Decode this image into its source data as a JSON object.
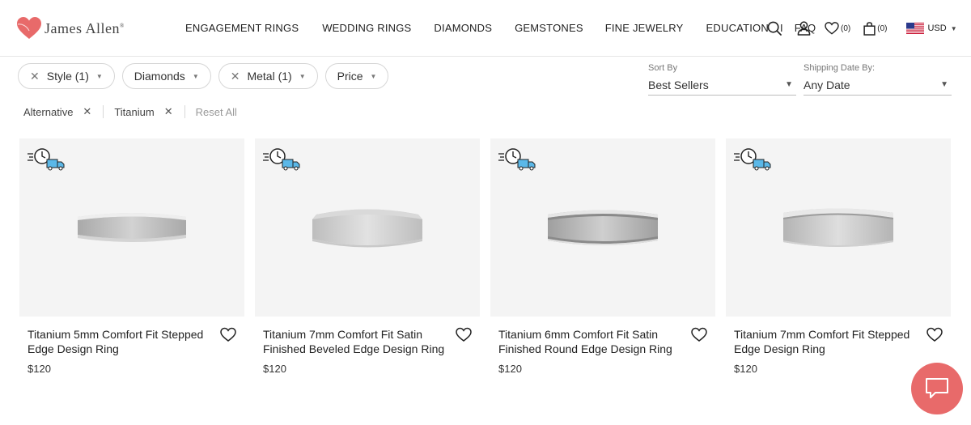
{
  "brand": {
    "name": "James Allen",
    "trademark": "®",
    "accent_color": "#e86a6a"
  },
  "nav": {
    "items": [
      "ENGAGEMENT RINGS",
      "WEDDING RINGS",
      "DIAMONDS",
      "GEMSTONES",
      "FINE JEWELRY",
      "EDUCATION"
    ],
    "separator": "I",
    "faq": "FAQ"
  },
  "header_icons": {
    "wishlist_count": "(0)",
    "cart_count": "(0)",
    "currency": "USD"
  },
  "filters": {
    "style": "Style (1)",
    "diamonds": "Diamonds",
    "metal": "Metal (1)",
    "price": "Price"
  },
  "sort": {
    "sort_by_label": "Sort By",
    "sort_by_value": "Best Sellers",
    "shipping_label": "Shipping Date By:",
    "shipping_value": "Any Date"
  },
  "applied_filters": {
    "tag1": "Alternative",
    "tag2": "Titanium",
    "reset": "Reset All"
  },
  "products": [
    {
      "title": "Titanium 5mm Comfort Fit Stepped Edge Design Ring",
      "price": "$120"
    },
    {
      "title": "Titanium 7mm Comfort Fit Satin Finished Beveled Edge Design Ring",
      "price": "$120"
    },
    {
      "title": "Titanium 6mm Comfort Fit Satin Finished Round Edge Design Ring",
      "price": "$120"
    },
    {
      "title": "Titanium 7mm Comfort Fit Stepped Edge Design Ring",
      "price": "$120"
    }
  ]
}
